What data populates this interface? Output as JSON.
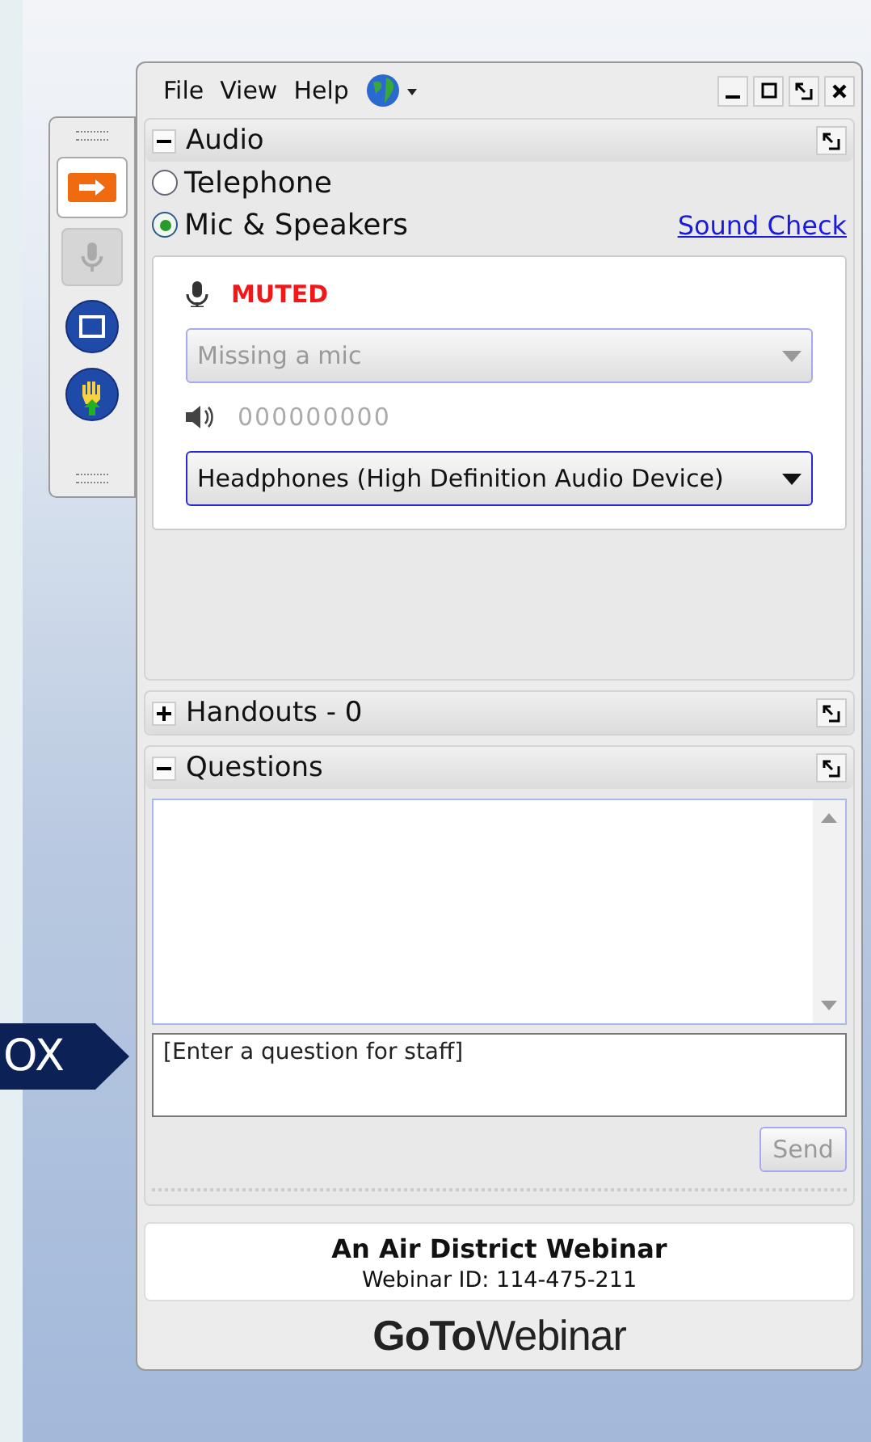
{
  "callout": {
    "text": "OX"
  },
  "toolbar": [
    {
      "kind": "arrow",
      "selected": true,
      "disabled": false
    },
    {
      "kind": "mic",
      "selected": false,
      "disabled": true
    },
    {
      "kind": "screen",
      "selected": false,
      "disabled": false
    },
    {
      "kind": "hand",
      "selected": false,
      "disabled": false
    }
  ],
  "menu": [
    "File",
    "View",
    "Help"
  ],
  "audio": {
    "title": "Audio",
    "expanded": true,
    "options": [
      {
        "label": "Telephone",
        "selected": false
      },
      {
        "label": "Mic & Speakers",
        "selected": true
      }
    ],
    "sound_check": "Sound Check",
    "mic_status": "MUTED",
    "mic_select": {
      "value": "Missing a mic",
      "disabled": true
    },
    "speaker_meter": "000000000",
    "speaker_select": {
      "value": "Headphones (High Definition Audio Device)",
      "disabled": false
    }
  },
  "handouts": {
    "title": "Handouts - 0",
    "expanded": false
  },
  "questions": {
    "title": "Questions",
    "expanded": true,
    "input_placeholder": "[Enter a question for staff]",
    "send": {
      "label": "Send",
      "disabled": true
    }
  },
  "webinar": {
    "title": "An Air District Webinar",
    "id": "Webinar ID: 114-475-211"
  },
  "logo": {
    "bold": "GoTo",
    "light": "Webinar"
  }
}
